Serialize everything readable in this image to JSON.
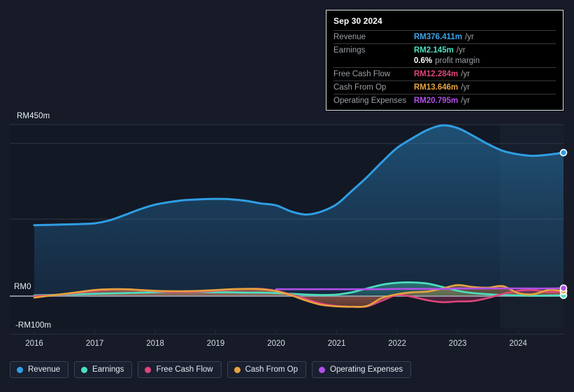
{
  "tooltip": {
    "date": "Sep 30 2024",
    "rows": [
      {
        "key": "Revenue",
        "value": "RM376.411m",
        "unit": "/yr",
        "color": "#3ba3e8"
      },
      {
        "key": "Earnings",
        "value": "RM2.145m",
        "unit": "/yr",
        "color": "#4ce0c0"
      },
      {
        "key": "",
        "value": "0.6%",
        "unit": "profit margin",
        "color": "#ffffff"
      },
      {
        "key": "Free Cash Flow",
        "value": "RM12.284m",
        "unit": "/yr",
        "color": "#e0457b"
      },
      {
        "key": "Cash From Op",
        "value": "RM13.646m",
        "unit": "/yr",
        "color": "#e8a33d"
      },
      {
        "key": "Operating Expenses",
        "value": "RM20.795m",
        "unit": "/yr",
        "color": "#b050e8"
      }
    ]
  },
  "legend": [
    {
      "label": "Revenue",
      "color": "#2f9ee3"
    },
    {
      "label": "Earnings",
      "color": "#4ce0c0"
    },
    {
      "label": "Free Cash Flow",
      "color": "#e0457b"
    },
    {
      "label": "Cash From Op",
      "color": "#e8a33d"
    },
    {
      "label": "Operating Expenses",
      "color": "#b050e8"
    }
  ],
  "axis": {
    "y_top_label": "RM450m",
    "y_zero_label": "RM0",
    "y_bottom_label": "-RM100m",
    "x_labels": [
      "2016",
      "2017",
      "2018",
      "2019",
      "2020",
      "2021",
      "2022",
      "2023",
      "2024"
    ]
  },
  "chart_data": {
    "type": "area",
    "title": "",
    "xlabel": "",
    "ylabel": "RM",
    "ylim": [
      -100,
      450
    ],
    "xlim": [
      2016,
      2024.75
    ],
    "grid": true,
    "legend_position": "bottom",
    "currency": "RM",
    "units": "millions",
    "x": [
      2016,
      2016.25,
      2016.5,
      2016.75,
      2017,
      2017.25,
      2017.5,
      2017.75,
      2018,
      2018.25,
      2018.5,
      2018.75,
      2019,
      2019.25,
      2019.5,
      2019.75,
      2020,
      2020.25,
      2020.5,
      2020.75,
      2021,
      2021.25,
      2021.5,
      2021.75,
      2022,
      2022.25,
      2022.5,
      2022.75,
      2023,
      2023.25,
      2023.5,
      2023.75,
      2024,
      2024.25,
      2024.5,
      2024.75
    ],
    "series": [
      {
        "name": "Revenue",
        "color": "#2f9ee3",
        "filled": true,
        "values": [
          186,
          187,
          188,
          189,
          191,
          199,
          213,
          228,
          240,
          247,
          252,
          254,
          255,
          254,
          250,
          243,
          238,
          222,
          214,
          222,
          241,
          276,
          312,
          352,
          389,
          414,
          436,
          448,
          441,
          421,
          399,
          381,
          372,
          368,
          371,
          376.411
        ]
      },
      {
        "name": "Earnings",
        "color": "#4ce0c0",
        "filled": true,
        "values": [
          2,
          3,
          4,
          5,
          6,
          7,
          8,
          9,
          10,
          11,
          11,
          11,
          10,
          10,
          9,
          9,
          8,
          6,
          4,
          3,
          4,
          10,
          20,
          30,
          35,
          36,
          33,
          24,
          14,
          8,
          5,
          3,
          2,
          1,
          1.5,
          2.145
        ]
      },
      {
        "name": "Free Cash Flow",
        "color": "#e0457b",
        "filled": true,
        "values": [
          0,
          2,
          5,
          9,
          14,
          17,
          18,
          16,
          13,
          11,
          11,
          12,
          14,
          17,
          19,
          19,
          14,
          4,
          -8,
          -20,
          -26,
          -28,
          -27,
          -12,
          3,
          -2,
          -11,
          -16,
          -14,
          -13,
          -5,
          6,
          14,
          16,
          11,
          12.284
        ]
      },
      {
        "name": "Cash From Op",
        "color": "#e8a33d",
        "filled": true,
        "values": [
          -4,
          1,
          6,
          11,
          16,
          18,
          18,
          16,
          14,
          13,
          13,
          14,
          16,
          18,
          19,
          18,
          13,
          2,
          -12,
          -23,
          -27,
          -28,
          -26,
          -5,
          5,
          10,
          12,
          20,
          29,
          24,
          22,
          26,
          8,
          5,
          16,
          13.646
        ]
      },
      {
        "name": "Operating Expenses",
        "color": "#b050e8",
        "filled": false,
        "start_index": 16,
        "values": [
          null,
          null,
          null,
          null,
          null,
          null,
          null,
          null,
          null,
          null,
          null,
          null,
          null,
          null,
          null,
          null,
          18,
          18,
          18,
          18,
          18,
          18,
          18,
          18,
          19,
          19,
          19,
          19,
          20,
          20,
          20,
          20,
          20,
          20,
          20,
          20.795
        ]
      }
    ]
  }
}
